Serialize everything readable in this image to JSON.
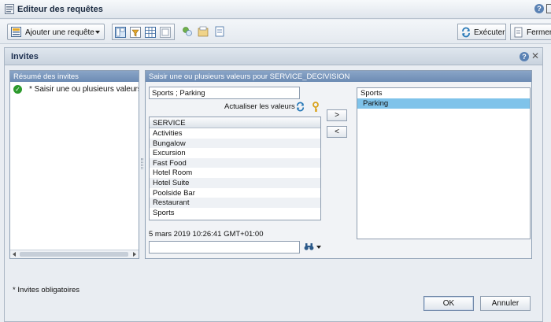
{
  "editor": {
    "title": "Editeur des requêtes",
    "help_glyph": "?"
  },
  "toolbar": {
    "add_query_label": "Ajouter une requête",
    "run_label": "Exécuter",
    "close_label": "Fermer"
  },
  "dialog": {
    "title": "Invites",
    "help_glyph": "?",
    "close_glyph": "✕",
    "summary": {
      "header": "Résumé des invites",
      "items": [
        "* Saisir une ou plusieurs valeurs"
      ]
    },
    "prompt": {
      "header": "Saisir une ou plusieurs valeurs pour SERVICE_DECIVISION",
      "value_input": "Sports ; Parking",
      "refresh_label": "Actualiser les valeurs",
      "list_header": "SERVICE",
      "list_items": [
        "Activities",
        "Bungalow",
        "Excursion",
        "Fast Food",
        "Hotel Room",
        "Hotel Suite",
        "Poolside Bar",
        "Restaurant",
        "Sports"
      ],
      "timestamp": "5 mars 2019 10:26:41 GMT+01:00",
      "search_value": "",
      "add_button": ">",
      "remove_button": "<",
      "selected_values": [
        "Sports",
        "Parking"
      ],
      "highlighted_index": 1
    },
    "mandatory_note": "* Invites obligatoires",
    "ok_label": "OK",
    "cancel_label": "Annuler"
  },
  "colors": {
    "panel_header": "#7593ba",
    "selection": "#7fc3ea",
    "check": "#2d9a2d"
  }
}
